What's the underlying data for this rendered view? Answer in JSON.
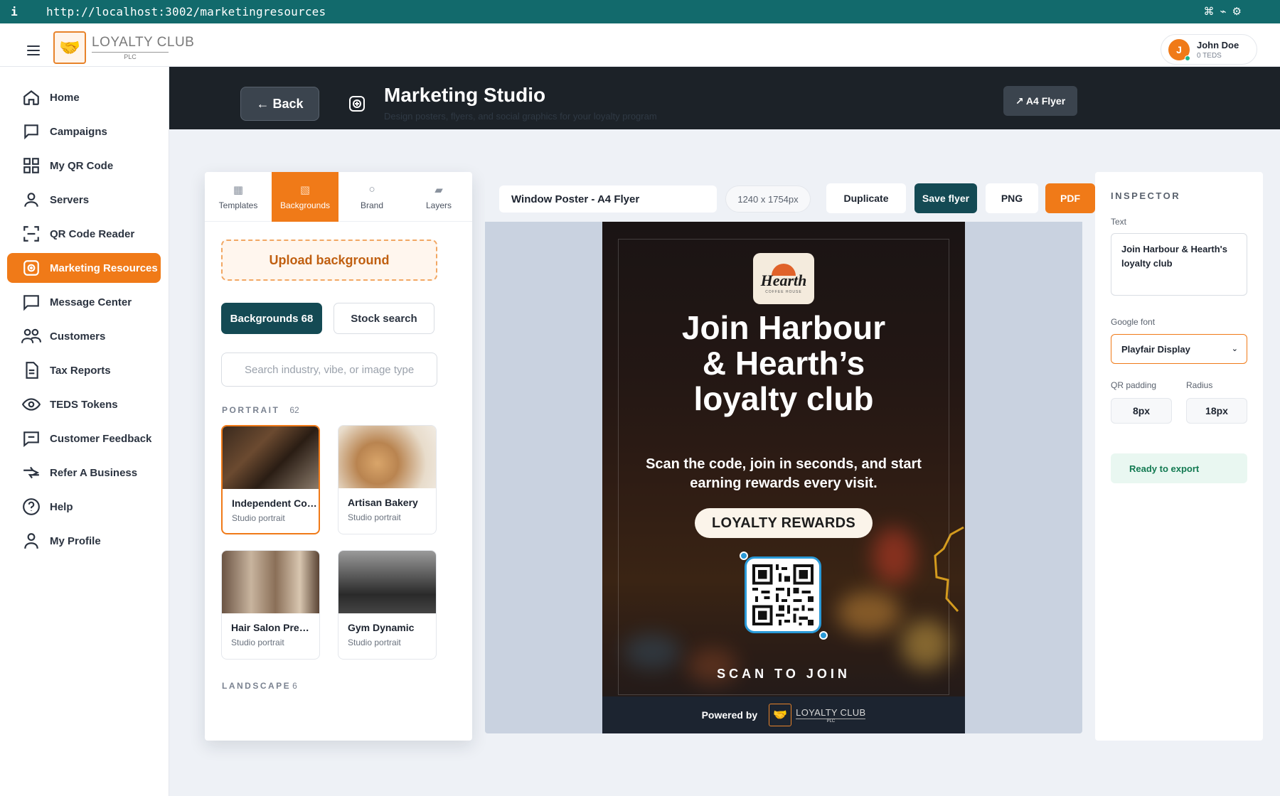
{
  "browser": {
    "info_icon": "i",
    "url": "http://localhost:3002/marketingresources",
    "tools": [
      "⌘",
      "⌁",
      "⚙"
    ]
  },
  "header": {
    "logo_line1": "LOYALTY CLUB",
    "logo_line2": "PLC",
    "user_name": "John Doe",
    "user_initial": "J",
    "user_balance": "0 TEDS"
  },
  "sidebar": {
    "items": [
      {
        "label": "Home",
        "icon": "home-icon",
        "active": false
      },
      {
        "label": "Campaigns",
        "icon": "campaign-icon",
        "active": false
      },
      {
        "label": "My QR Code",
        "icon": "grid-icon",
        "active": false
      },
      {
        "label": "Servers",
        "icon": "user-icon",
        "active": false
      },
      {
        "label": "QR Code Reader",
        "icon": "scan-icon",
        "active": false
      },
      {
        "label": "Marketing Resources",
        "icon": "marketing-icon",
        "active": true
      },
      {
        "label": "Message Center",
        "icon": "message-icon",
        "active": false
      },
      {
        "label": "Customers",
        "icon": "users-icon",
        "active": false
      },
      {
        "label": "Tax Reports",
        "icon": "document-icon",
        "active": false
      },
      {
        "label": "TEDS Tokens",
        "icon": "eye-icon",
        "active": false
      },
      {
        "label": "Customer Feedback",
        "icon": "feedback-icon",
        "active": false
      },
      {
        "label": "Refer A Business",
        "icon": "refer-icon",
        "active": false
      },
      {
        "label": "Help",
        "icon": "help-icon",
        "active": false
      },
      {
        "label": "My Profile",
        "icon": "profile-icon",
        "active": false
      }
    ]
  },
  "studio": {
    "back_label": "← Back",
    "title": "Marketing Studio",
    "subtitle": "Design posters, flyers, and social graphics for your loyalty program",
    "format_chip": "↗ A4 Flyer"
  },
  "left_panel": {
    "tabs": [
      {
        "label": "Templates",
        "icon": "▦",
        "active": false
      },
      {
        "label": "Backgrounds",
        "icon": "▧",
        "active": true
      },
      {
        "label": "Brand",
        "icon": "○",
        "active": false
      },
      {
        "label": "Layers",
        "icon": "▰",
        "active": false
      }
    ],
    "upload_label": "Upload background",
    "backgrounds_label": "Backgrounds 68",
    "stock_label": "Stock search",
    "search_placeholder": "Search industry, vibe, or image type",
    "portrait_label": "PORTRAIT",
    "portrait_count": "62",
    "landscape_label": "LANDSCAPE",
    "landscape_count": "6",
    "cards": [
      {
        "title": "Independent Coffee Shop",
        "subtitle": "Studio portrait",
        "selected": true
      },
      {
        "title": "Artisan Bakery",
        "subtitle": "Studio portrait",
        "selected": false
      },
      {
        "title": "Hair Salon Premium",
        "subtitle": "Studio portrait",
        "selected": false
      },
      {
        "title": "Gym Dynamic",
        "subtitle": "Studio portrait",
        "selected": false
      }
    ]
  },
  "canvas": {
    "name_value": "Window Poster - A4 Flyer",
    "dimensions": "1240 x 1754px",
    "duplicate_label": "Duplicate",
    "save_label": "Save flyer",
    "png_label": "PNG",
    "pdf_label": "PDF"
  },
  "poster": {
    "logo_word": "Hearth",
    "logo_small": "COFFEE HOUSE",
    "headline_1": "Join Harbour",
    "headline_2": "& Hearth’s",
    "headline_3": "loyalty club",
    "sub_1": "Scan the code, join in seconds, and start",
    "sub_2": "earning rewards every visit.",
    "pill": "LOYALTY REWARDS",
    "scan_label": "SCAN TO JOIN",
    "powered_by": "Powered by",
    "footer_logo_1": "LOYALTY CLUB",
    "footer_logo_2": "PLC"
  },
  "inspector": {
    "title": "INSPECTOR",
    "text_label": "Text",
    "text_value": "Join Harbour & Hearth's loyalty club",
    "font_label": "Google font",
    "font_value": "Playfair Display",
    "qr_padding_label": "QR padding",
    "qr_padding_value": "8px",
    "radius_label": "Radius",
    "radius_value": "18px",
    "status": "Ready to export"
  }
}
